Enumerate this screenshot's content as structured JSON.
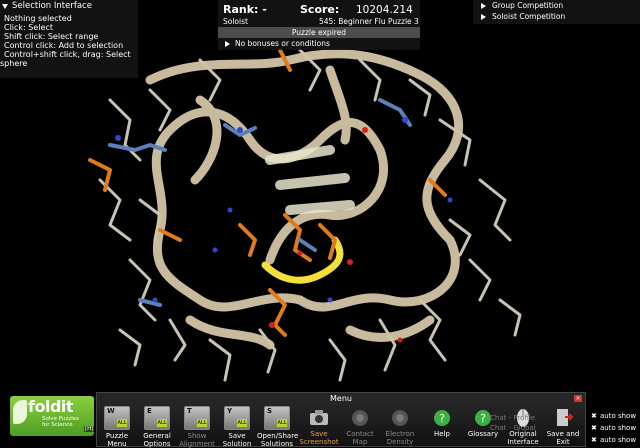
{
  "selection": {
    "title": "Selection Interface",
    "lines": [
      "Nothing selected",
      "Click: Select",
      "Shift click: Select range",
      "Control click: Add to selection",
      "Control+shift click, drag: Select",
      "sphere"
    ]
  },
  "score_panel": {
    "rank_label": "Rank: -",
    "score_label": "Score:",
    "score_value": "10204.214",
    "mode": "Soloist",
    "puzzle": "545: Beginner Flu Puzzle 3",
    "status": "Puzzle expired",
    "bonus": "No bonuses or conditions"
  },
  "competition": {
    "items": [
      "Group Competition",
      "Soloist Competition"
    ]
  },
  "logo": {
    "name": "foldit",
    "tagline_1": "Solve Puzzles",
    "tagline_2": "for Science",
    "hotkey": "[H]"
  },
  "menu": {
    "title": "Menu",
    "items": [
      {
        "label": "Puzzle",
        "label2": "Menu",
        "key": "W"
      },
      {
        "label": "General",
        "label2": "Options",
        "key": "E"
      },
      {
        "label": "Show",
        "label2": "Alignment",
        "key": "T"
      },
      {
        "label": "Save",
        "label2": "Solution",
        "key": "Y"
      },
      {
        "label": "Open/Share",
        "label2": "Solutions",
        "key": "S"
      },
      {
        "label": "Save",
        "label2": "Screenshot"
      },
      {
        "label": "Contact",
        "label2": "Map"
      },
      {
        "label": "Electron",
        "label2": "Density"
      },
      {
        "label": "Help",
        "label2": ""
      },
      {
        "label": "Glossary",
        "label2": ""
      },
      {
        "label": "Original",
        "label2": "Interface"
      },
      {
        "label": "Save and",
        "label2": "Exit"
      }
    ]
  },
  "chat": {
    "line1": "Chat - Profile",
    "line2": "Chat - Global",
    "auto_show": "auto show"
  },
  "colors": {
    "backbone": "#d2c5a6",
    "sidechain_orange": "#e07b19",
    "highlight_yellow": "#f4e03a",
    "carbon": "#c9c3b3",
    "nitrogen": "#3146c8",
    "oxygen": "#d62020"
  }
}
